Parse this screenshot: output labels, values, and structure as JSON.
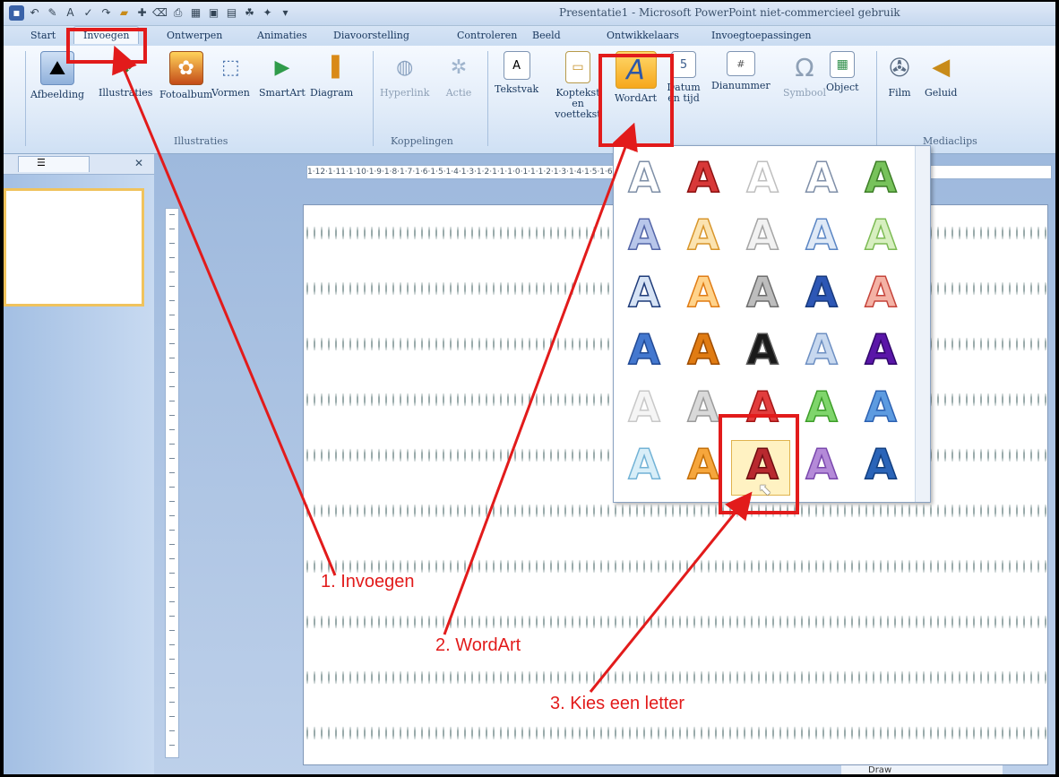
{
  "window": {
    "title": "Presentatie1 - Microsoft PowerPoint niet-commercieel gebruik"
  },
  "tabs": [
    "Start",
    "Invoegen",
    "Ontwerpen",
    "Animaties",
    "Diavoorstelling",
    "Controleren",
    "Beeld",
    "Ontwikkelaars",
    "Invoegtoepassingen"
  ],
  "ribbon": {
    "illustraties": {
      "label": "Illustraties",
      "buttons": [
        "Afbeelding",
        "Illustraties",
        "Fotoalbum",
        "Vormen",
        "SmartArt",
        "Diagram"
      ]
    },
    "koppelingen": {
      "label": "Koppelingen",
      "buttons": [
        "Hyperlink",
        "Actie"
      ]
    },
    "tekst": {
      "buttons": [
        "Tekstvak",
        "Koptekst en voettekst",
        "WordArt",
        "Datum en tijd",
        "Dianummer",
        "Symbool",
        "Object"
      ]
    },
    "mediaclips": {
      "label": "Mediaclips",
      "buttons": [
        "Film",
        "Geluid"
      ]
    }
  },
  "ruler": {
    "horizontal": "1·12·1·11·1·10·1·9·1·8·1·7·1·6·1·5·1·4·1·3·1·2·1·1·1·0·1·1·1·2·1·3·1·4·1·5·1·6·1·7·1·8·1·9·1·10·1·11·1·12·1"
  },
  "wordart_gallery": {
    "styles": [
      {
        "fill": "#ffffff",
        "stroke": "#7d8ea6"
      },
      {
        "fill": "#d83838",
        "stroke": "#8c1010"
      },
      {
        "fill": "#ffffff",
        "stroke": "#bfbfbf"
      },
      {
        "fill": "#ffffff",
        "stroke": "#7f8fa8"
      },
      {
        "fill": "#77c25b",
        "stroke": "#3d7e27"
      },
      {
        "fill": "#b8c6ea",
        "stroke": "#5466a8"
      },
      {
        "fill": "#fbe3b0",
        "stroke": "#d8962c"
      },
      {
        "fill": "#f2f2f2",
        "stroke": "#a5a5a5"
      },
      {
        "fill": "#dfe9f6",
        "stroke": "#5b86c4"
      },
      {
        "fill": "#d7efc0",
        "stroke": "#7dbb55"
      },
      {
        "fill": "#d6e3f5",
        "stroke": "#1f3c7a"
      },
      {
        "fill": "#ffd38b",
        "stroke": "#e07c15"
      },
      {
        "fill": "#bdbdbd",
        "stroke": "#6e6e6e"
      },
      {
        "fill": "#2d57b5",
        "stroke": "#183a7d"
      },
      {
        "fill": "#f4b2a5",
        "stroke": "#c5443b"
      },
      {
        "fill": "#4478cf",
        "stroke": "#224a95"
      },
      {
        "fill": "#e07b12",
        "stroke": "#9e4c00"
      },
      {
        "fill": "#1a1a1a",
        "stroke": "#5a5a5a"
      },
      {
        "fill": "#c7d8ef",
        "stroke": "#6d8fc2"
      },
      {
        "fill": "#5a16a8",
        "stroke": "#30076b"
      },
      {
        "fill": "#f5f5f5",
        "stroke": "#c8c8c8"
      },
      {
        "fill": "#d9d9d9",
        "stroke": "#9b9b9b"
      },
      {
        "fill": "#e23d3d",
        "stroke": "#a31616"
      },
      {
        "fill": "#7fd56b",
        "stroke": "#3e9e2a"
      },
      {
        "fill": "#5d9be0",
        "stroke": "#2d62b2"
      },
      {
        "fill": "#d8eef8",
        "stroke": "#73b3d6"
      },
      {
        "fill": "#f6a63c",
        "stroke": "#c46f08"
      },
      {
        "fill": "#b8292f",
        "stroke": "#6e0c10"
      },
      {
        "fill": "#b48ad8",
        "stroke": "#7a48ad"
      },
      {
        "fill": "#2a64b8",
        "stroke": "#123f80"
      }
    ]
  },
  "annotations": {
    "step1": "1. Invoegen",
    "step2": "2. WordArt",
    "step3": "3. Kies een letter",
    "color": "#e21b1b"
  },
  "status": {
    "label": "Draw"
  }
}
